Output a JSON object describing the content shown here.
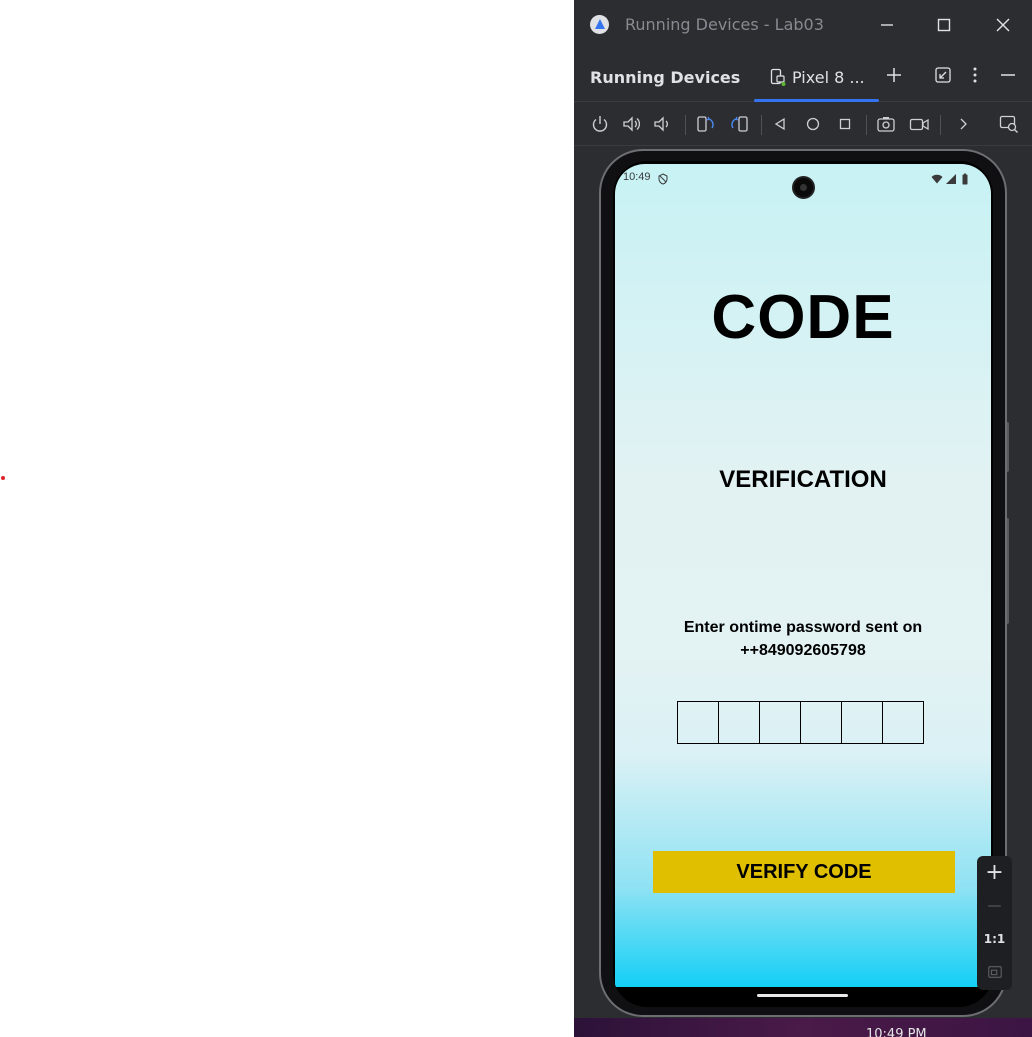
{
  "window": {
    "title": "Running Devices - Lab03",
    "app_icon": "android-studio-icon",
    "controls": [
      "minimize-icon",
      "maximize-icon",
      "close-icon"
    ]
  },
  "tool_window": {
    "title": "Running Devices",
    "device_tab": {
      "label": "Pixel 8 ...",
      "icon": "device-icon"
    },
    "header_icons": [
      "add-icon",
      "restore-icon",
      "more-options-icon",
      "hide-icon"
    ]
  },
  "toolbar": {
    "icons": [
      "power-icon",
      "volume-up-icon",
      "volume-down-icon",
      "rotate-left-icon",
      "rotate-right-icon",
      "back-icon",
      "home-icon",
      "overview-icon",
      "screenshot-icon",
      "screen-record-icon",
      "more-chevron-icon",
      "device-explorer-icon"
    ]
  },
  "device": {
    "status_time": "10:49",
    "screen": {
      "title": "CODE",
      "subtitle": "VERIFICATION",
      "instruction": "Enter ontime password sent on",
      "phone_number": "++849092605798",
      "otp_box_count": 6,
      "verify_button": "VERIFY CODE"
    },
    "colors": {
      "button": "#e0bf00",
      "gradient_top": "#c7f2f4",
      "gradient_bottom": "#14cff6"
    }
  },
  "zoom_panel": {
    "zoom_in": "+",
    "zoom_out": "—",
    "actual_size": "1:1"
  },
  "taskbar": {
    "clock_partial": "10:49 PM"
  }
}
